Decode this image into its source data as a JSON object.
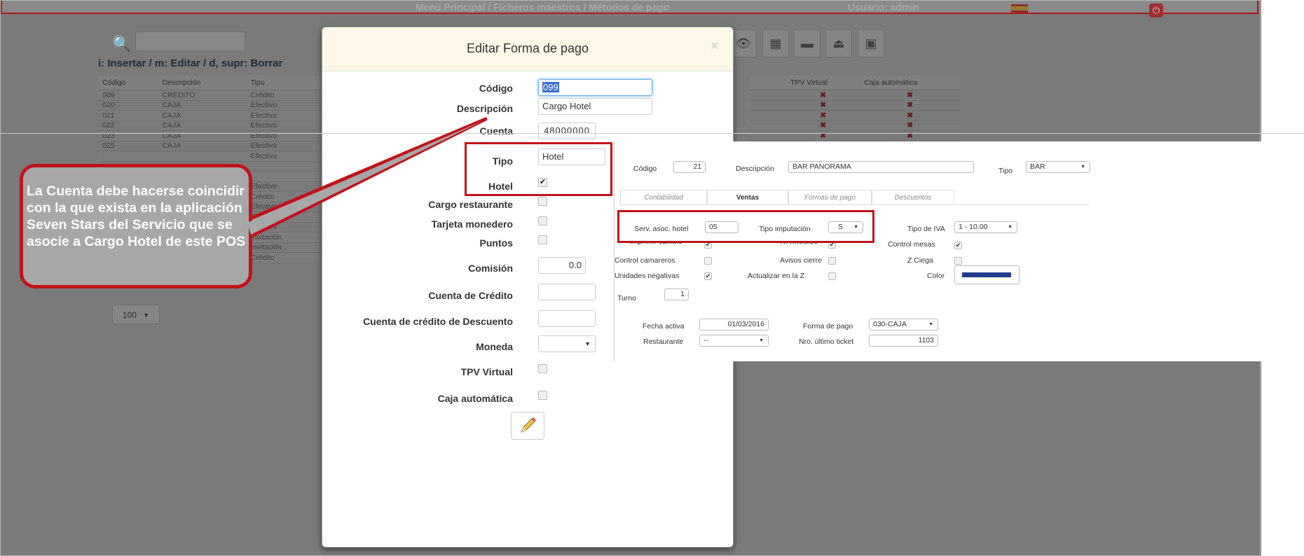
{
  "topbar": {
    "breadcrumb": "Menú Principal /  Ficheros maestros /  Métodos de pago",
    "user": "Usuario: admin"
  },
  "toolbar": {
    "hint": "i: Insertar / m: Editar / d, supr: Borrar"
  },
  "grid": {
    "headers": [
      "Código",
      "Descripción",
      "Tipo"
    ],
    "rows": [
      [
        "009",
        "CREDITO",
        "Crédito"
      ],
      [
        "020",
        "CAJA",
        "Efectivo"
      ],
      [
        "021",
        "CAJA",
        "Efectivo"
      ],
      [
        "022",
        "CAJA",
        "Efectivo"
      ],
      [
        "023",
        "CAJA",
        "Efectivo"
      ],
      [
        "025",
        "CAJA",
        "Efectivo"
      ],
      [
        "",
        "",
        "Efectivo"
      ],
      [
        "",
        "",
        ""
      ],
      [
        "",
        "",
        ""
      ],
      [
        "",
        "",
        "Efectivo"
      ],
      [
        "",
        "",
        "Crédito"
      ],
      [
        "",
        "",
        "Efectivo"
      ],
      [
        "",
        "",
        "Efectivo"
      ],
      [
        "",
        "",
        "Efectivo"
      ],
      [
        "",
        "",
        "Invitación"
      ],
      [
        "",
        "",
        "Invitación"
      ],
      [
        "",
        "",
        "Crédito"
      ]
    ],
    "right_headers": [
      "TPV Virtual",
      "Caja automática"
    ],
    "mark": "✖",
    "page_size": "100"
  },
  "modal": {
    "title": "Editar Forma de pago",
    "close": "×",
    "fields": {
      "codigo_label": "Código",
      "codigo_value": "099",
      "descripcion_label": "Descripción",
      "descripcion_value": "Cargo Hotel",
      "cuenta_label": "Cuenta",
      "cuenta_value": "48000000",
      "tipo_label": "Tipo",
      "tipo_value": "Hotel",
      "hotel_label": "Hotel",
      "cargo_label": "Cargo restaurante",
      "tarjeta_label": "Tarjeta monedero",
      "puntos_label": "Puntos",
      "comision_label": "Comisión",
      "comision_value": "0.0",
      "cuenta_credito_label": "Cuenta de Crédito",
      "cuenta_desc_label": "Cuenta de crédito de Descuento",
      "moneda_label": "Moneda",
      "tpv_label": "TPV Virtual",
      "caja_label": "Caja automática"
    }
  },
  "panel": {
    "codigo_label": "Código",
    "codigo_value": "21",
    "descripcion_label": "Descripción",
    "descripcion_value": "BAR PANORAMA",
    "tipo_label": "Tipo",
    "tipo_value": "BAR",
    "tabs": [
      "Contabilidad",
      "Ventas",
      "Formas de pago",
      "Descuentos"
    ],
    "serv_label": "Serv. asoc. hotel",
    "serv_value": "05",
    "imput_label": "Tipo imputación",
    "imput_value": "S",
    "iva_label": "Tipo de IVA",
    "iva_value": "1 - 10.00",
    "imprimir_label": "Imprimir cambio",
    "iva_incl_label": "IVA incluido",
    "control_mesas_label": "Control mesas",
    "control_cam_label": "Control camareros",
    "avisos_label": "Avisos cierre",
    "zciega_label": "Z Ciega",
    "unid_label": "Unidades negativas",
    "actualizar_label": "Actualizar en la Z",
    "color_label": "Color",
    "color_value": "#1f3d8a",
    "turno_label": "Turno",
    "turno_value": "1",
    "fecha_label": "Fecha activa",
    "fecha_value": "01/03/2016",
    "forma_label": "Forma de pago",
    "forma_value": "030-CAJA",
    "rest_label": "Restaurante",
    "rest_value": "--",
    "nro_label": "Nro. último ticket",
    "nro_value": "1103"
  },
  "callout": {
    "text": "La Cuenta debe hacerse coincidir con la que exista en la aplicación Seven  Stars del Servicio que se asocie a Cargo Hotel de este POS"
  },
  "colors": {
    "highlight": "#c0141a",
    "callout_bg": "#a7a7a7",
    "modal_header": "#fcf7e6"
  },
  "icons": [
    "search-icon",
    "eye-icon",
    "export-icon",
    "print-icon",
    "upload-icon",
    "print-red-icon",
    "pencil-icon",
    "power-icon",
    "flag-icon",
    "checkmark-icon"
  ]
}
